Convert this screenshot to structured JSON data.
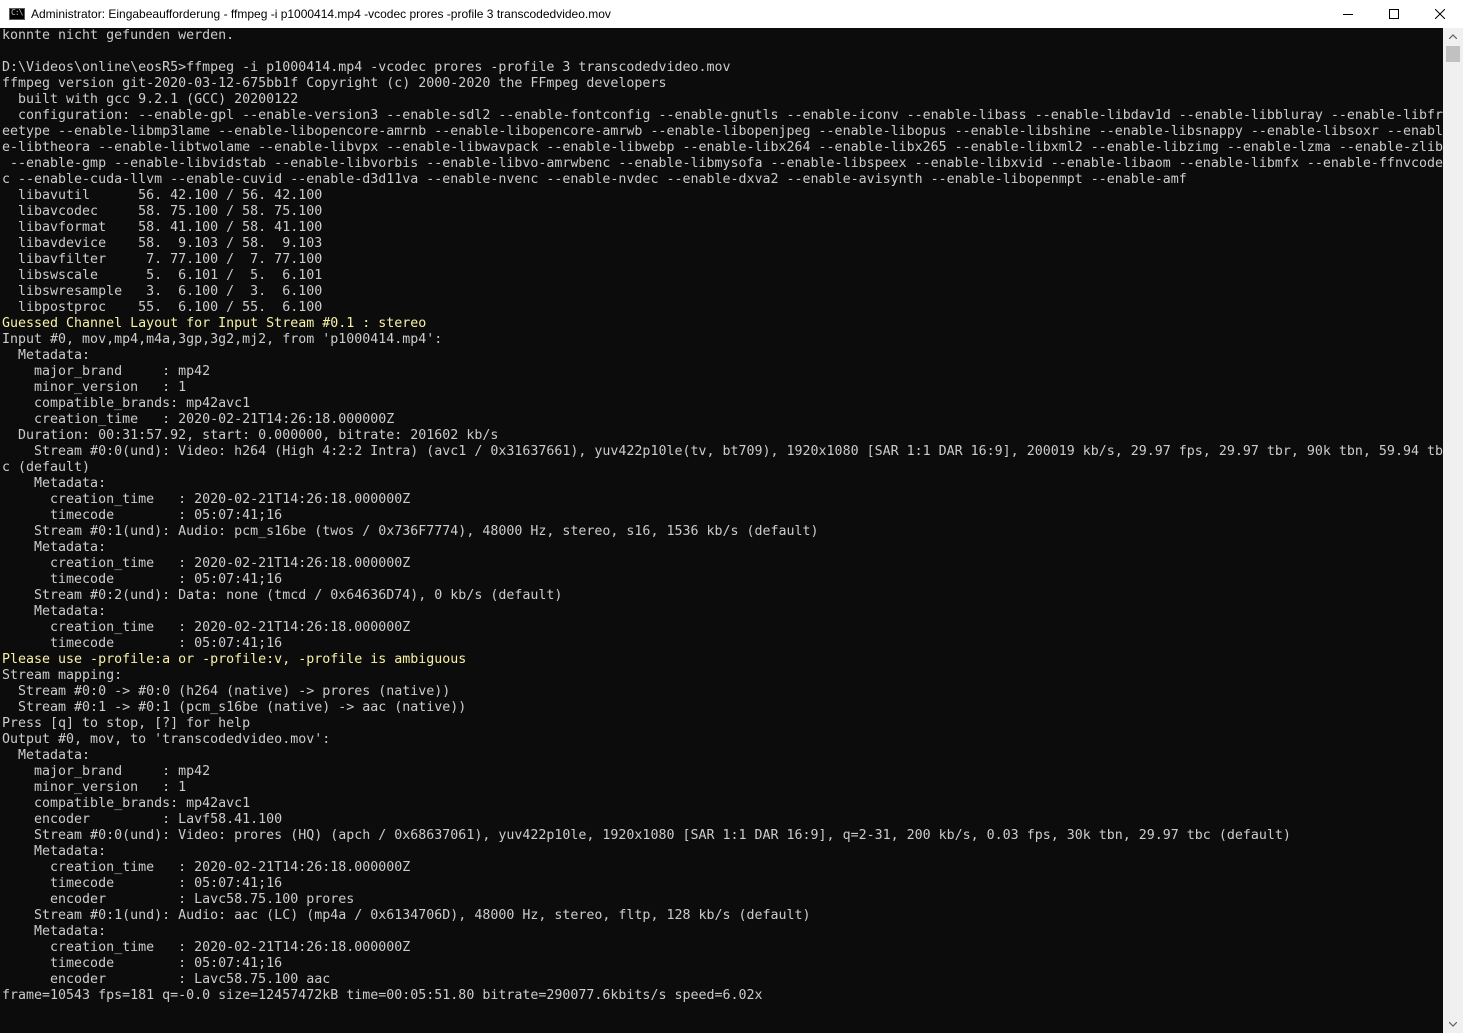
{
  "window": {
    "title": "Administrator: Eingabeaufforderung - ffmpeg  -i p1000414.mp4 -vcodec prores -profile 3 transcodedvideo.mov",
    "app_icon": "console-icon",
    "app_icon_glyph": "C:\\",
    "controls": {
      "minimize": "minimize-icon",
      "maximize": "maximize-icon",
      "close": "close-icon"
    }
  },
  "colors": {
    "background": "#0c0c0c",
    "text": "#cccccc",
    "warning_text": "#f9f1a5",
    "titlebar": "#ffffff",
    "scrollbar": "#f0f0f0"
  },
  "console": {
    "lines": [
      {
        "text": "konnte nicht gefunden werden."
      },
      {
        "text": ""
      },
      {
        "text": "D:\\Videos\\online\\eosR5>ffmpeg -i p1000414.mp4 -vcodec prores -profile 3 transcodedvideo.mov"
      },
      {
        "text": "ffmpeg version git-2020-03-12-675bb1f Copyright (c) 2000-2020 the FFmpeg developers"
      },
      {
        "text": "  built with gcc 9.2.1 (GCC) 20200122"
      },
      {
        "text": "  configuration: --enable-gpl --enable-version3 --enable-sdl2 --enable-fontconfig --enable-gnutls --enable-iconv --enable-libass --enable-libdav1d --enable-libbluray --enable-libfr"
      },
      {
        "text": "eetype --enable-libmp3lame --enable-libopencore-amrnb --enable-libopencore-amrwb --enable-libopenjpeg --enable-libopus --enable-libshine --enable-libsnappy --enable-libsoxr --enabl"
      },
      {
        "text": "e-libtheora --enable-libtwolame --enable-libvpx --enable-libwavpack --enable-libwebp --enable-libx264 --enable-libx265 --enable-libxml2 --enable-libzimg --enable-lzma --enable-zlib"
      },
      {
        "text": " --enable-gmp --enable-libvidstab --enable-libvorbis --enable-libvo-amrwbenc --enable-libmysofa --enable-libspeex --enable-libxvid --enable-libaom --enable-libmfx --enable-ffnvcode"
      },
      {
        "text": "c --enable-cuda-llvm --enable-cuvid --enable-d3d11va --enable-nvenc --enable-nvdec --enable-dxva2 --enable-avisynth --enable-libopenmpt --enable-amf"
      },
      {
        "text": "  libavutil      56. 42.100 / 56. 42.100"
      },
      {
        "text": "  libavcodec     58. 75.100 / 58. 75.100"
      },
      {
        "text": "  libavformat    58. 41.100 / 58. 41.100"
      },
      {
        "text": "  libavdevice    58.  9.103 / 58.  9.103"
      },
      {
        "text": "  libavfilter     7. 77.100 /  7. 77.100"
      },
      {
        "text": "  libswscale      5.  6.101 /  5.  6.101"
      },
      {
        "text": "  libswresample   3.  6.100 /  3.  6.100"
      },
      {
        "text": "  libpostproc    55.  6.100 / 55.  6.100"
      },
      {
        "text": "Guessed Channel Layout for Input Stream #0.1 : stereo",
        "warn": true
      },
      {
        "text": "Input #0, mov,mp4,m4a,3gp,3g2,mj2, from 'p1000414.mp4':"
      },
      {
        "text": "  Metadata:"
      },
      {
        "text": "    major_brand     : mp42"
      },
      {
        "text": "    minor_version   : 1"
      },
      {
        "text": "    compatible_brands: mp42avc1"
      },
      {
        "text": "    creation_time   : 2020-02-21T14:26:18.000000Z"
      },
      {
        "text": "  Duration: 00:31:57.92, start: 0.000000, bitrate: 201602 kb/s"
      },
      {
        "text": "    Stream #0:0(und): Video: h264 (High 4:2:2 Intra) (avc1 / 0x31637661), yuv422p10le(tv, bt709), 1920x1080 [SAR 1:1 DAR 16:9], 200019 kb/s, 29.97 fps, 29.97 tbr, 90k tbn, 59.94 tb"
      },
      {
        "text": "c (default)"
      },
      {
        "text": "    Metadata:"
      },
      {
        "text": "      creation_time   : 2020-02-21T14:26:18.000000Z"
      },
      {
        "text": "      timecode        : 05:07:41;16"
      },
      {
        "text": "    Stream #0:1(und): Audio: pcm_s16be (twos / 0x736F7774), 48000 Hz, stereo, s16, 1536 kb/s (default)"
      },
      {
        "text": "    Metadata:"
      },
      {
        "text": "      creation_time   : 2020-02-21T14:26:18.000000Z"
      },
      {
        "text": "      timecode        : 05:07:41;16"
      },
      {
        "text": "    Stream #0:2(und): Data: none (tmcd / 0x64636D74), 0 kb/s (default)"
      },
      {
        "text": "    Metadata:"
      },
      {
        "text": "      creation_time   : 2020-02-21T14:26:18.000000Z"
      },
      {
        "text": "      timecode        : 05:07:41;16"
      },
      {
        "text": "Please use -profile:a or -profile:v, -profile is ambiguous",
        "warn": true
      },
      {
        "text": "Stream mapping:"
      },
      {
        "text": "  Stream #0:0 -> #0:0 (h264 (native) -> prores (native))"
      },
      {
        "text": "  Stream #0:1 -> #0:1 (pcm_s16be (native) -> aac (native))"
      },
      {
        "text": "Press [q] to stop, [?] for help"
      },
      {
        "text": "Output #0, mov, to 'transcodedvideo.mov':"
      },
      {
        "text": "  Metadata:"
      },
      {
        "text": "    major_brand     : mp42"
      },
      {
        "text": "    minor_version   : 1"
      },
      {
        "text": "    compatible_brands: mp42avc1"
      },
      {
        "text": "    encoder         : Lavf58.41.100"
      },
      {
        "text": "    Stream #0:0(und): Video: prores (HQ) (apch / 0x68637061), yuv422p10le, 1920x1080 [SAR 1:1 DAR 16:9], q=2-31, 200 kb/s, 0.03 fps, 30k tbn, 29.97 tbc (default)"
      },
      {
        "text": "    Metadata:"
      },
      {
        "text": "      creation_time   : 2020-02-21T14:26:18.000000Z"
      },
      {
        "text": "      timecode        : 05:07:41;16"
      },
      {
        "text": "      encoder         : Lavc58.75.100 prores"
      },
      {
        "text": "    Stream #0:1(und): Audio: aac (LC) (mp4a / 0x6134706D), 48000 Hz, stereo, fltp, 128 kb/s (default)"
      },
      {
        "text": "    Metadata:"
      },
      {
        "text": "      creation_time   : 2020-02-21T14:26:18.000000Z"
      },
      {
        "text": "      timecode        : 05:07:41;16"
      },
      {
        "text": "      encoder         : Lavc58.75.100 aac"
      },
      {
        "text": "frame=10543 fps=181 q=-0.0 size=12457472kB time=00:05:51.80 bitrate=290077.6kbits/s speed=6.02x"
      }
    ]
  },
  "scrollbar": {
    "up_icon": "scroll-up-arrow-icon",
    "down_icon": "scroll-down-arrow-icon"
  }
}
